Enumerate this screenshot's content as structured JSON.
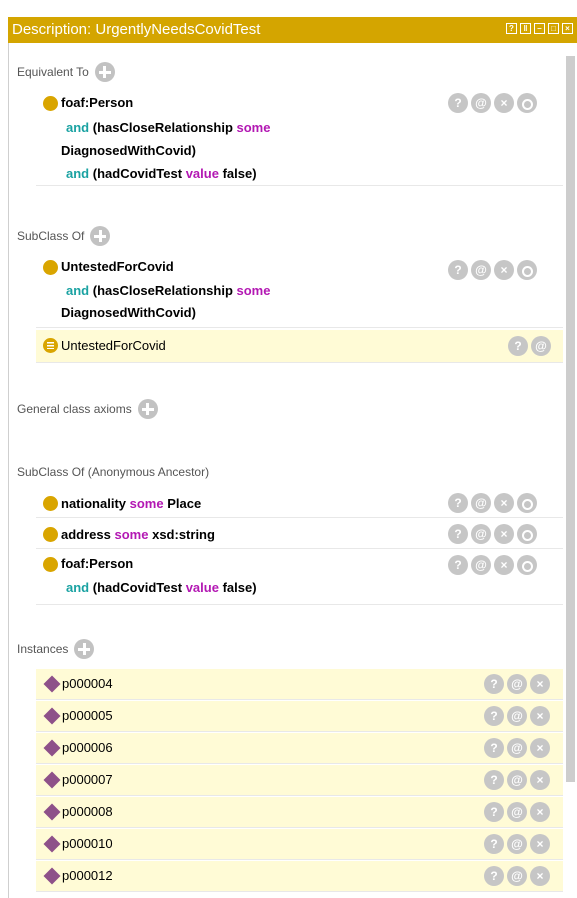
{
  "title": "Description: UrgentlyNeedsCovidTest",
  "window_buttons": [
    "?",
    "split-icon",
    "minimize-icon",
    "maximize-icon",
    "close-icon"
  ],
  "sections": {
    "equivalent": "Equivalent To",
    "subclass": "SubClass Of",
    "general": "General class axioms",
    "ancestor": "SubClass Of (Anonymous Ancestor)",
    "instances": "Instances"
  },
  "equivalent": {
    "class": "foaf:Person",
    "and1": "and",
    "prop1": "(hasCloseRelationship",
    "some1": "some",
    "target1": "DiagnosedWithCovid)",
    "and2": "and",
    "prop2": "(hadCovidTest",
    "value_kw": "value",
    "value": "false)"
  },
  "subclass": {
    "class": "UntestedForCovid",
    "and1": "and",
    "prop1": "(hasCloseRelationship",
    "some1": "some",
    "target1": "DiagnosedWithCovid)",
    "inferred": "UntestedForCovid"
  },
  "ancestor": {
    "r1_prop": "nationality",
    "r1_some": "some",
    "r1_target": "Place",
    "r2_prop": "address",
    "r2_some": "some",
    "r2_target": "xsd:string",
    "r3_class": "foaf:Person",
    "r3_and": "and",
    "r3_prop": "(hadCovidTest",
    "r3_value_kw": "value",
    "r3_value": "false)"
  },
  "instances": [
    "p000004",
    "p000005",
    "p000006",
    "p000007",
    "p000008",
    "p000010",
    "p000012"
  ],
  "button_glyphs": {
    "help": "?",
    "annotate": "@",
    "delete": "×"
  },
  "colors": {
    "title_bar": "#d4a500",
    "class_dot": "#d9a500",
    "individual": "#8e5189",
    "keyword": "#b318b3",
    "and": "#1aa2a2",
    "highlight": "#fffbd6"
  }
}
